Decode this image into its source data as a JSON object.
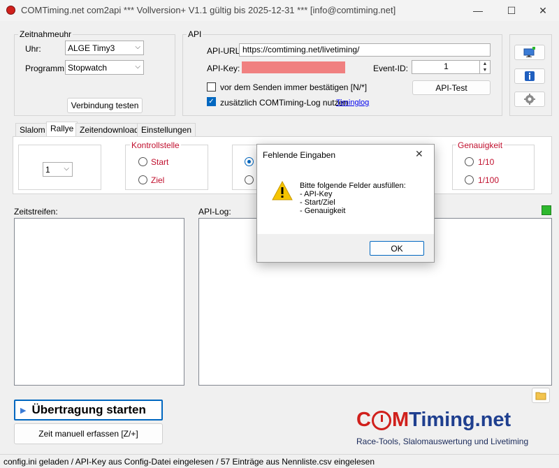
{
  "window": {
    "title": "COMTiming.net com2api *** Vollversion+ V1.1 gültig bis 2025-12-31 *** [info@comtiming.net]",
    "minimize": "—",
    "maximize": "☐",
    "close": "✕"
  },
  "zeitnahmeuhr": {
    "title": "Zeitnahmeuhr",
    "uhr_label": "Uhr:",
    "uhr_value": "ALGE Timy3",
    "programm_label": "Programm:",
    "programm_value": "Stopwatch",
    "test_button": "Verbindung testen"
  },
  "api": {
    "title": "API",
    "url_label": "API-URL:",
    "url_value": "https://comtiming.net/livetiming/",
    "key_label": "API-Key:",
    "key_value": "",
    "event_label": "Event-ID:",
    "event_value": "1",
    "confirm_label": "vor dem Senden immer bestätigen [N/*]",
    "confirm_checked": false,
    "log_label": "zusätzlich COMTiming-Log nutzen",
    "log_checked": true,
    "log_link": "Timinglog",
    "test_button": "API-Test",
    "error_color": "#f08080"
  },
  "side_buttons": [
    "monitor-add-icon",
    "info-icon",
    "gear-icon"
  ],
  "tabs": [
    "Slalom",
    "Rallye",
    "Zeitendownload",
    "Einstellungen"
  ],
  "rallye": {
    "dropdown_value": "1",
    "kontrollstelle": {
      "title": "Kontrollstelle",
      "options": [
        "Start",
        "Ziel"
      ]
    },
    "genauigkeit": {
      "title": "Genauigkeit",
      "options": [
        "1/10",
        "1/100"
      ]
    }
  },
  "zeitstreifen_label": "Zeitstreifen:",
  "api_log_label": "API-Log:",
  "status_indicator_color": "#2eb82e",
  "start_button": "Übertragung starten",
  "manual_button": "Zeit manuell erfassen [Z/+]",
  "logo": {
    "brand_prefix": "C",
    "brand_o": "O",
    "brand_mid": "M",
    "brand_suffix": "Timing.net",
    "tagline": "Race-Tools, Slalomauswertung und Livetiming",
    "red": "#d0201c",
    "blue": "#1f3f8f"
  },
  "dialog": {
    "title": "Fehlende Eingaben",
    "message_heading": "Bitte folgende Felder ausfüllen:",
    "items": [
      "- API-Key",
      "- Start/Ziel",
      "- Genauigkeit"
    ],
    "ok_button": "OK"
  },
  "statusbar": "config.ini geladen / API-Key aus Config-Datei eingelesen / 57 Einträge aus Nennliste.csv eingelesen"
}
